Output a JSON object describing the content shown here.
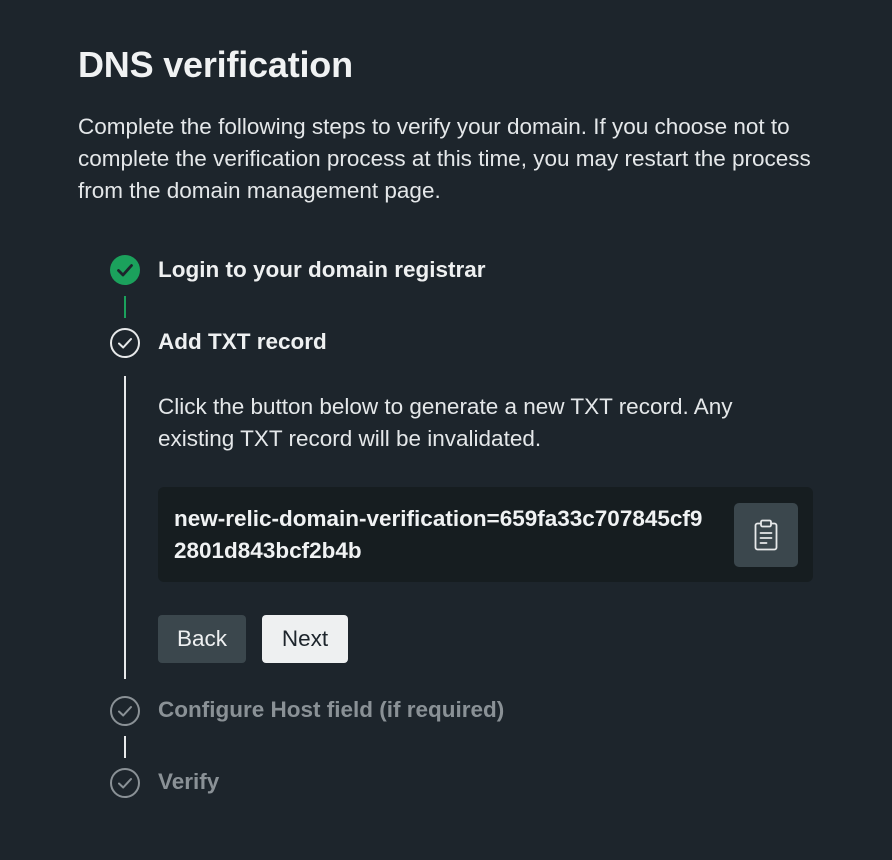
{
  "page": {
    "title": "DNS verification",
    "intro": "Complete the following steps to verify your domain. If you choose not to complete the verification process at this time, you may restart the process from the domain management page."
  },
  "steps": [
    {
      "label": "Login to your domain registrar",
      "status": "completed",
      "icon": "check-circle-filled-icon"
    },
    {
      "label": "Add TXT record",
      "status": "current",
      "icon": "check-circle-outline-icon"
    },
    {
      "label": "Configure Host field (if required)",
      "status": "upcoming",
      "icon": "check-circle-outline-icon"
    },
    {
      "label": "Verify",
      "status": "upcoming",
      "icon": "check-circle-outline-icon"
    }
  ],
  "txt_step": {
    "description": "Click the button below to generate a new TXT record. Any existing TXT record will be invalidated.",
    "record_value": "new-relic-domain-verification=659fa33c707845cf92801d843bcf2b4b",
    "copy_icon": "clipboard-icon",
    "back_label": "Back",
    "next_label": "Next"
  },
  "colors": {
    "background": "#1d252c",
    "success": "#1ba15c",
    "record_box": "#161d20",
    "secondary_button": "#3b474d",
    "primary_button": "#eef0f1",
    "muted_text": "#8a9196"
  }
}
